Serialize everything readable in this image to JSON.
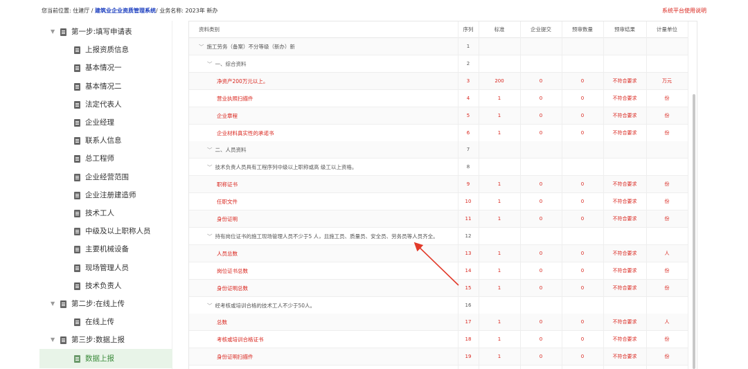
{
  "breadcrumb": {
    "prefix": "您当前位置: 住建厅 / ",
    "system": "建筑业企业资质管理系统",
    "suffix": "/ 业务名称: 2023年 新办"
  },
  "help_link": "系统平台使用说明",
  "sidebar": {
    "items": [
      {
        "label": "第一步:填写申请表",
        "level": 0,
        "expandable": true
      },
      {
        "label": "上报资质信息",
        "level": 1
      },
      {
        "label": "基本情况一",
        "level": 1
      },
      {
        "label": "基本情况二",
        "level": 1
      },
      {
        "label": "法定代表人",
        "level": 1
      },
      {
        "label": "企业经理",
        "level": 1
      },
      {
        "label": "联系人信息",
        "level": 1
      },
      {
        "label": "总工程师",
        "level": 1
      },
      {
        "label": "企业经营范围",
        "level": 1
      },
      {
        "label": "企业注册建造师",
        "level": 1
      },
      {
        "label": "技术工人",
        "level": 1
      },
      {
        "label": "中级及以上职称人员",
        "level": 1
      },
      {
        "label": "主要机械设备",
        "level": 1
      },
      {
        "label": "现场管理人员",
        "level": 1
      },
      {
        "label": "技术负责人",
        "level": 1
      },
      {
        "label": "第二步:在线上传",
        "level": 0,
        "expandable": true
      },
      {
        "label": "在线上传",
        "level": 1
      },
      {
        "label": "第三步:数据上报",
        "level": 0,
        "expandable": true
      },
      {
        "label": "数据上报",
        "level": 1,
        "active": true
      }
    ]
  },
  "table": {
    "headers": [
      "资料类别",
      "序列",
      "标准",
      "企业提交",
      "预审数量",
      "预审结果",
      "计量单位"
    ],
    "rows": [
      {
        "name": "施工劳务（备案）不分等级（新办）新",
        "seq": "1",
        "group": true,
        "indent": 0
      },
      {
        "name": "一、综合资料",
        "seq": "2",
        "group": true,
        "indent": 1
      },
      {
        "name": "净资产200万元以上。",
        "seq": "3",
        "std": "200",
        "sub": "0",
        "pre": "0",
        "result": "不符合要求",
        "unit": "万元",
        "indent": 2
      },
      {
        "name": "营业执照扫描件",
        "seq": "4",
        "std": "1",
        "sub": "0",
        "pre": "0",
        "result": "不符合要求",
        "unit": "份",
        "indent": 2
      },
      {
        "name": "企业章程",
        "seq": "5",
        "std": "1",
        "sub": "0",
        "pre": "0",
        "result": "不符合要求",
        "unit": "份",
        "indent": 2
      },
      {
        "name": "企业材料真实性的承诺书",
        "seq": "6",
        "std": "1",
        "sub": "0",
        "pre": "0",
        "result": "不符合要求",
        "unit": "份",
        "indent": 2
      },
      {
        "name": "二、人员资料",
        "seq": "7",
        "group": true,
        "indent": 1
      },
      {
        "name": "技术负责人员具有工程序列中级以上职称或高 级工以上资格。",
        "seq": "8",
        "group": true,
        "indent": 1
      },
      {
        "name": "职称证书",
        "seq": "9",
        "std": "1",
        "sub": "0",
        "pre": "0",
        "result": "不符合要求",
        "unit": "份",
        "indent": 2
      },
      {
        "name": "任职文件",
        "seq": "10",
        "std": "1",
        "sub": "0",
        "pre": "0",
        "result": "不符合要求",
        "unit": "份",
        "indent": 2
      },
      {
        "name": "身份证明",
        "seq": "11",
        "std": "1",
        "sub": "0",
        "pre": "0",
        "result": "不符合要求",
        "unit": "份",
        "indent": 2
      },
      {
        "name": "持有岗位证书的施工现场管理人员不少于5 人，且施工员、质量员、安全员、劳务员等人员齐全。",
        "seq": "12",
        "group": true,
        "indent": 1
      },
      {
        "name": "人员总数",
        "seq": "13",
        "std": "1",
        "sub": "0",
        "pre": "0",
        "result": "不符合要求",
        "unit": "人",
        "indent": 2
      },
      {
        "name": "岗位证书总数",
        "seq": "14",
        "std": "1",
        "sub": "0",
        "pre": "0",
        "result": "不符合要求",
        "unit": "份",
        "indent": 2
      },
      {
        "name": "身份证明总数",
        "seq": "15",
        "std": "1",
        "sub": "0",
        "pre": "0",
        "result": "不符合要求",
        "unit": "份",
        "indent": 2
      },
      {
        "name": "经考核或培训合格的技术工人不少于50人。",
        "seq": "16",
        "group": true,
        "indent": 1
      },
      {
        "name": "总数",
        "seq": "17",
        "std": "1",
        "sub": "0",
        "pre": "0",
        "result": "不符合要求",
        "unit": "人",
        "indent": 2
      },
      {
        "name": "考核或培训合格证书",
        "seq": "18",
        "std": "1",
        "sub": "0",
        "pre": "0",
        "result": "不符合要求",
        "unit": "份",
        "indent": 2
      },
      {
        "name": "身份证明扫描件",
        "seq": "19",
        "std": "1",
        "sub": "0",
        "pre": "0",
        "result": "不符合要求",
        "unit": "份",
        "indent": 2
      }
    ]
  },
  "colors": {
    "accent_red": "#d9241c",
    "link_blue": "#1a3dbf",
    "active_green": "#3a8a3a"
  }
}
